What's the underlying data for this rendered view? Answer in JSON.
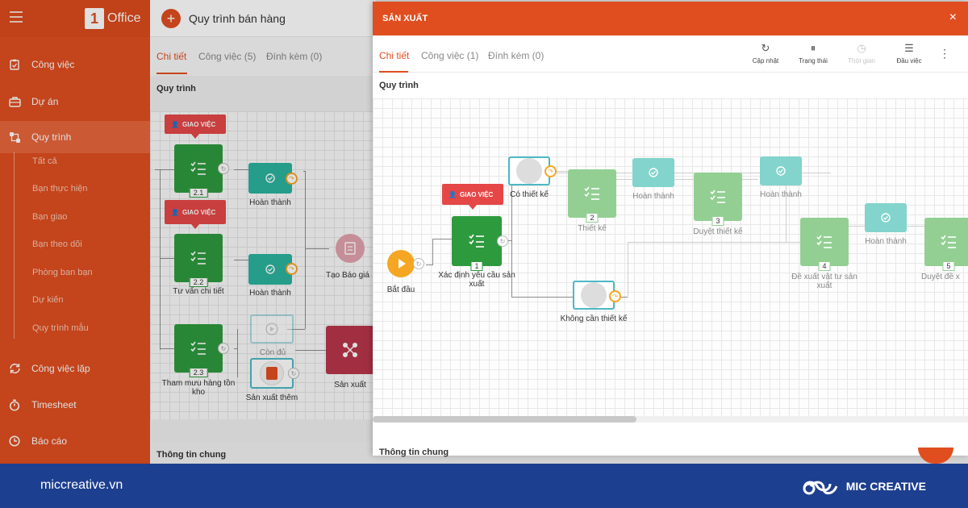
{
  "sidebar": {
    "logo_text": "Office",
    "logo_mark": "1",
    "items": [
      {
        "label": "Công việc",
        "icon": "clipboard-icon"
      },
      {
        "label": "Dự án",
        "icon": "briefcase-icon"
      },
      {
        "label": "Quy trình",
        "icon": "workflow-icon"
      },
      {
        "label": "Công việc lặp",
        "icon": "repeat-icon"
      },
      {
        "label": "Timesheet",
        "icon": "stopwatch-icon"
      },
      {
        "label": "Báo cáo",
        "icon": "clock-report-icon"
      }
    ],
    "subitems": [
      "Tất cả",
      "Bạn thực hiện",
      "Bạn giao",
      "Bạn theo dõi",
      "Phòng ban bạn",
      "Dự kiến",
      "Quy trình mẫu"
    ]
  },
  "background": {
    "title": "Quy trình bán hàng",
    "tabs": [
      "Chi tiết",
      "Công việc (5)",
      "Đính kèm (0)"
    ],
    "section_process": "Quy trình",
    "section_info": "Thông tin chung",
    "badge": "GIAO VIỆC",
    "nodes": {
      "n21": "2.1",
      "n22": "2.2",
      "n23": "2.3",
      "done1": "Hoàn thành",
      "done2": "Hoàn thành",
      "tuvan": "Tư vấn chi tiết",
      "thammuu": "Tham mưu hàng tồn kho",
      "condu": "Còn đủ",
      "sxthem": "Sản xuất thêm",
      "sanxuat": "Sản xuất",
      "baogia": "Tạo Báo giá"
    }
  },
  "modal": {
    "title": "SẢN XUẤT",
    "close": "×",
    "tabs": [
      "Chi tiết",
      "Công việc (1)",
      "Đính kèm (0)"
    ],
    "tools": [
      "Cập nhật",
      "Trạng thái",
      "Thời gian",
      "Đầu việc"
    ],
    "section_process": "Quy trình",
    "section_info": "Thông tin chung",
    "badge": "GIAO VIỆC",
    "nodes": {
      "start": "Bắt đầu",
      "xacdinh": "Xác định yêu cầu sản xuất",
      "n1": "1",
      "cothietke": "Có thiết kế",
      "khongcan": "Không cần thiết kế",
      "thietke": "Thiết kế",
      "n2": "2",
      "hoanthanh1": "Hoàn thành",
      "duyet": "Duyệt thiết kế",
      "n3": "3",
      "hoanthanh2": "Hoàn thành",
      "dexuat": "Đề xuất vật tư sản xuất",
      "n4": "4",
      "hoanthanh3": "Hoàn thành",
      "duyetde": "Duyệt đề x",
      "n5": "5"
    }
  },
  "footer": {
    "url": "miccreative.vn",
    "brand": "MIC CREATIVE"
  },
  "colors": {
    "brand_orange": "#e04e1f",
    "task_green": "#2e9a3e",
    "done_teal": "#2bb39e",
    "footer_blue": "#1d3f8f",
    "badge_red": "#e54747",
    "start_orange": "#f5a623"
  }
}
